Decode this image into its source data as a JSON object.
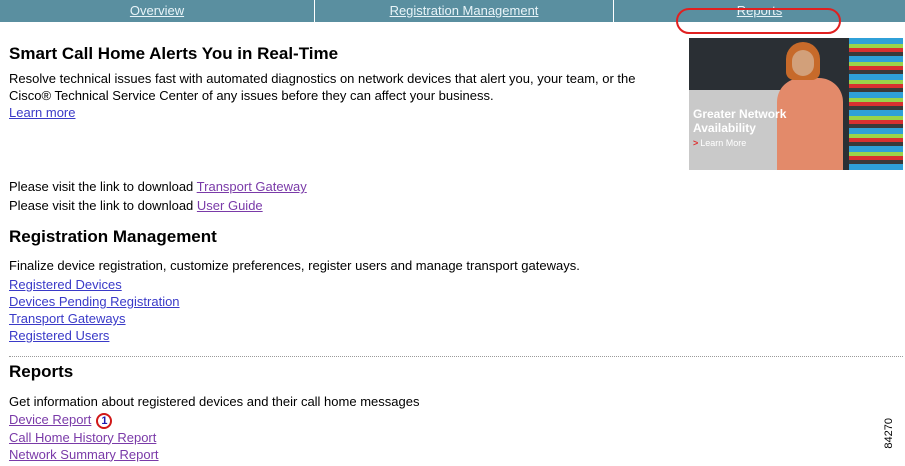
{
  "tabs": [
    {
      "label": "Overview"
    },
    {
      "label": "Registration Management"
    },
    {
      "label": "Reports"
    }
  ],
  "hero": {
    "title": "Smart Call Home Alerts You in Real-Time",
    "desc": "Resolve technical issues fast with automated diagnostics on network devices that alert you, your team, or the Cisco® Technical Service Center of any issues before they can affect your business.",
    "learn_more": "Learn more"
  },
  "promo": {
    "line1": "Greater Network",
    "line2": "Availability",
    "cta": "Learn More"
  },
  "downloads": {
    "prefix": "Please visit the link to download",
    "transport_gateway": "Transport Gateway",
    "user_guide": "User Guide"
  },
  "registration": {
    "title": "Registration Management",
    "desc": "Finalize device registration, customize preferences, register users and manage transport gateways.",
    "links": [
      "Registered Devices",
      "Devices Pending Registration",
      "Transport Gateways",
      "Registered Users"
    ]
  },
  "reports": {
    "title": "Reports",
    "desc": "Get information about registered devices and their call home messages",
    "links": [
      "Device Report",
      "Call Home History Report",
      "Network Summary Report"
    ],
    "callout_number": "1"
  },
  "figure_number": "84270",
  "colors": {
    "tab_bar": "#5a8fa0",
    "highlight": "#e02020",
    "link": "#3a3ac8"
  }
}
